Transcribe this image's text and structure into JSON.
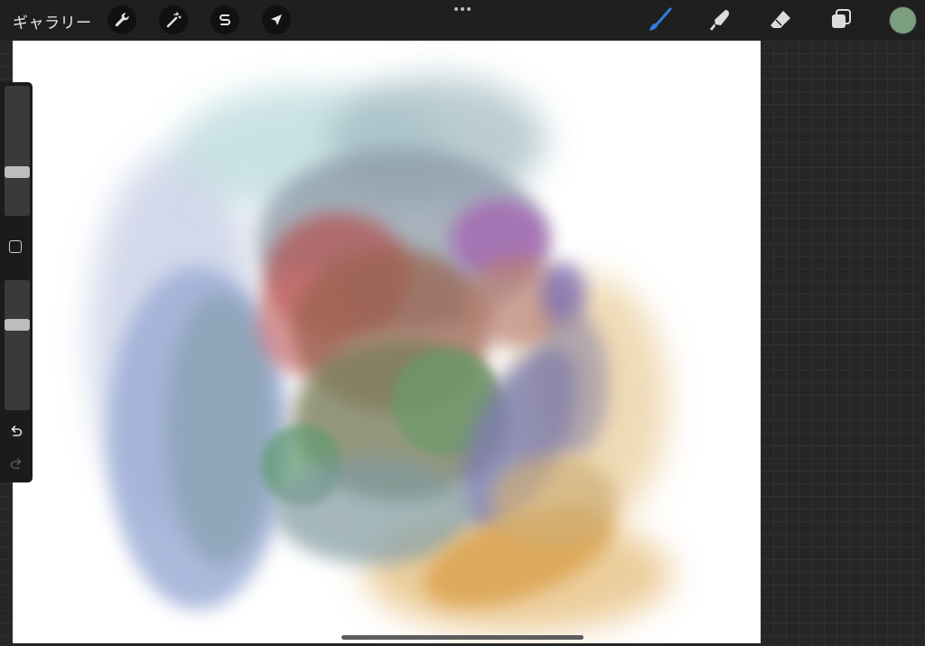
{
  "topbar": {
    "gallery_label": "ギャラリー",
    "left_tools": [
      {
        "name": "actions",
        "icon": "wrench-icon"
      },
      {
        "name": "adjustments",
        "icon": "magic-wand-icon"
      },
      {
        "name": "selection",
        "icon": "selection-s-icon"
      },
      {
        "name": "transform",
        "icon": "arrow-cursor-icon"
      }
    ],
    "more_icon": "ellipsis-icon",
    "right_tools": [
      {
        "name": "brush",
        "icon": "brush-icon",
        "active": true
      },
      {
        "name": "smudge",
        "icon": "smudge-finger-icon"
      },
      {
        "name": "eraser",
        "icon": "eraser-icon"
      },
      {
        "name": "layers",
        "icon": "layers-icon"
      }
    ],
    "current_color": "#7a9e7e",
    "accent_color": "#2f7de1"
  },
  "sidebar": {
    "brush_size_level": 0.36,
    "opacity_level": 0.33,
    "modify_button_icon": "square-icon",
    "undo_icon": "undo-arrow-icon",
    "redo_icon": "redo-arrow-icon",
    "redo_enabled": false
  },
  "canvas": {
    "background": "#ffffff",
    "content": "watercolor-blob-painting"
  }
}
